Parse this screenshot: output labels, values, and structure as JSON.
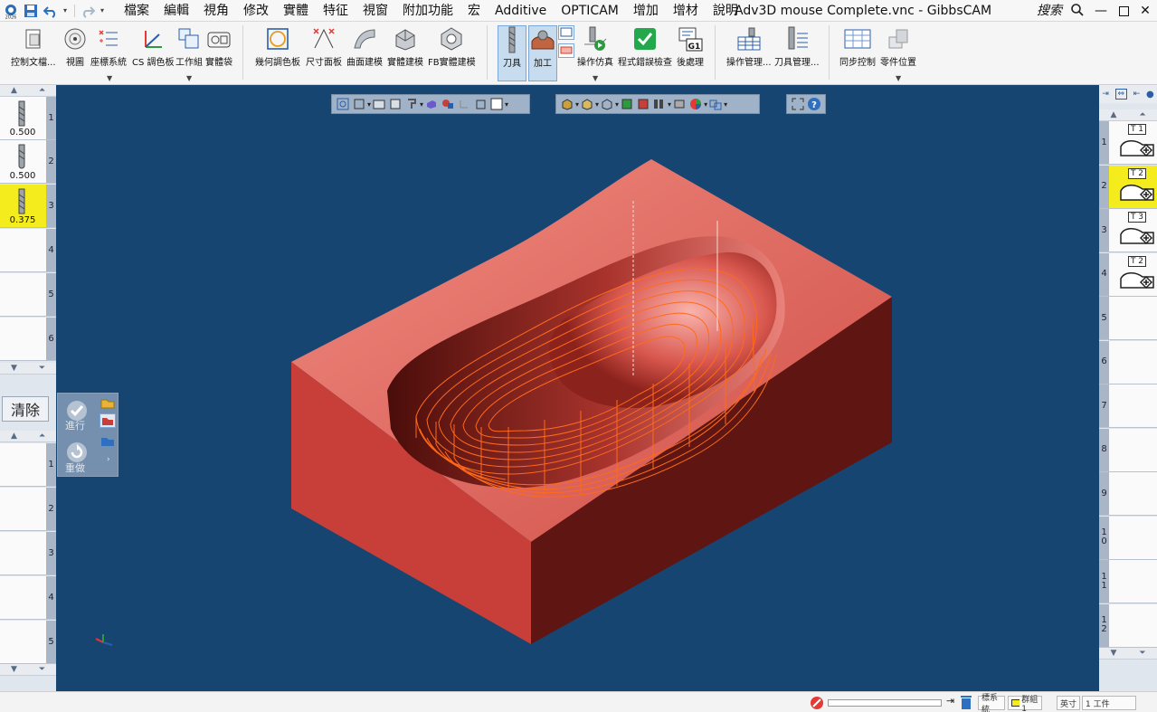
{
  "window": {
    "title": "Adv3D mouse Complete.vnc - GibbsCAM",
    "search_label": "搜索"
  },
  "quick_access": {
    "logo_year": "2026"
  },
  "menu": [
    "檔案",
    "編輯",
    "視角",
    "修改",
    "實體",
    "特征",
    "視窗",
    "附加功能",
    "宏",
    "Additive",
    "OPTICAM",
    "增加",
    "增材",
    "說明"
  ],
  "ribbon": {
    "buttons": [
      {
        "id": "control-doc",
        "label": "控制文檔..."
      },
      {
        "id": "view",
        "label": "視圖"
      },
      {
        "id": "coord-sys",
        "label": "座標系統"
      },
      {
        "id": "cs-palette",
        "label": "CS 調色板"
      },
      {
        "id": "workgroup",
        "label": "工作組"
      },
      {
        "id": "solid-bag",
        "label": "實體袋"
      },
      {
        "id": "geom-palette",
        "label": "幾何調色板"
      },
      {
        "id": "dim-panel",
        "label": "尺寸面板"
      },
      {
        "id": "surface-model",
        "label": "曲面建模"
      },
      {
        "id": "solid-model",
        "label": "實體建模"
      },
      {
        "id": "fb-solid-model",
        "label": "FB實體建模"
      },
      {
        "id": "tool",
        "label": "刀具"
      },
      {
        "id": "machining",
        "label": "加工"
      },
      {
        "id": "op-sim",
        "label": "操作仿真"
      },
      {
        "id": "prog-check",
        "label": "程式錯誤檢查"
      },
      {
        "id": "post",
        "label": "後處理"
      },
      {
        "id": "op-manager",
        "label": "操作管理..."
      },
      {
        "id": "tool-manager",
        "label": "刀具管理..."
      },
      {
        "id": "sync-control",
        "label": "同步控制"
      },
      {
        "id": "part-position",
        "label": "零件位置"
      }
    ],
    "post_badge": "G1"
  },
  "tool_list": [
    {
      "num": "1",
      "dia": "0.500"
    },
    {
      "num": "2",
      "dia": "0.500"
    },
    {
      "num": "3",
      "dia": "0.375"
    },
    {
      "num": "4",
      "dia": ""
    },
    {
      "num": "5",
      "dia": ""
    },
    {
      "num": "6",
      "dia": ""
    }
  ],
  "lower_list": [
    {
      "num": "1"
    },
    {
      "num": "2"
    },
    {
      "num": "3"
    },
    {
      "num": "4"
    },
    {
      "num": "5"
    }
  ],
  "clear_label": "清除",
  "float_panel": {
    "run_label": "進行",
    "redo_label": "重做"
  },
  "process_list": [
    {
      "num": "1",
      "tool": "T 1"
    },
    {
      "num": "2",
      "tool": "T 2"
    },
    {
      "num": "3",
      "tool": "T 3"
    },
    {
      "num": "4",
      "tool": "T 2"
    },
    {
      "num": "5",
      "tool": ""
    },
    {
      "num": "6",
      "tool": ""
    },
    {
      "num": "7",
      "tool": ""
    },
    {
      "num": "8",
      "tool": ""
    },
    {
      "num": "9",
      "tool": ""
    },
    {
      "num": "1\n0",
      "tool": ""
    },
    {
      "num": "1\n1",
      "tool": ""
    },
    {
      "num": "1\n2",
      "tool": ""
    }
  ],
  "status": {
    "coord_label": "標系統",
    "group_label": "群組1",
    "units": "英寸",
    "parts": "1 工件"
  },
  "colors": {
    "viewport_bg": "#164572",
    "part_top": "#e2675e",
    "part_front": "#c73f38",
    "part_side": "#5f1612",
    "toolpath": "#ff6a1a",
    "highlight": "#f5ec1d"
  }
}
